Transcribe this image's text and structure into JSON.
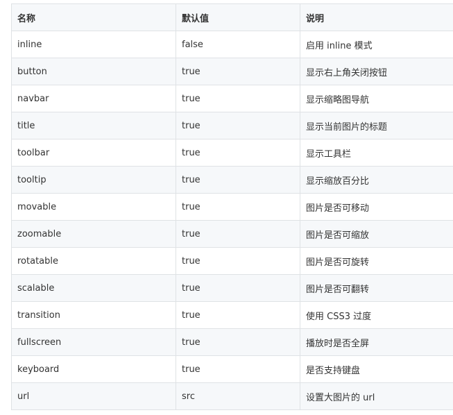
{
  "table": {
    "headers": [
      "名称",
      "默认值",
      "说明"
    ],
    "rows": [
      [
        "inline",
        "false",
        "启用 inline 模式"
      ],
      [
        "button",
        "true",
        "显示右上角关闭按钮"
      ],
      [
        "navbar",
        "true",
        "显示缩略图导航"
      ],
      [
        "title",
        "true",
        "显示当前图片的标题"
      ],
      [
        "toolbar",
        "true",
        "显示工具栏"
      ],
      [
        "tooltip",
        "true",
        "显示缩放百分比"
      ],
      [
        "movable",
        "true",
        "图片是否可移动"
      ],
      [
        "zoomable",
        "true",
        "图片是否可缩放"
      ],
      [
        "rotatable",
        "true",
        "图片是否可旋转"
      ],
      [
        "scalable",
        "true",
        "图片是否可翻转"
      ],
      [
        "transition",
        "true",
        "使用 CSS3 过度"
      ],
      [
        "fullscreen",
        "true",
        "播放时是否全屏"
      ],
      [
        "keyboard",
        "true",
        "是否支持键盘"
      ],
      [
        "url",
        "src",
        "设置大图片的 url"
      ]
    ]
  }
}
